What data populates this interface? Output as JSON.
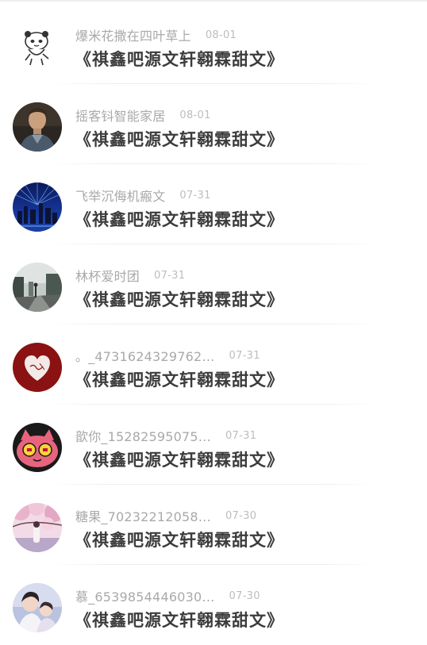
{
  "comments": [
    {
      "user": "爆米花撒在四叶草上",
      "date": "08-01",
      "text": "《祺鑫吧源文轩翱霖甜文》",
      "avatar_icon": "panda-sticker-avatar"
    },
    {
      "user": "摇客钭智能家居",
      "date": "08-01",
      "text": "《祺鑫吧源文轩翱霖甜文》",
      "avatar_icon": "man-portrait-avatar"
    },
    {
      "user": "飞举沉侮机瘢文",
      "date": "07-31",
      "text": "《祺鑫吧源文轩翱霖甜文》",
      "avatar_icon": "city-night-avatar"
    },
    {
      "user": "林杯爱时团",
      "date": "07-31",
      "text": "《祺鑫吧源文轩翱霖甜文》",
      "avatar_icon": "city-street-avatar"
    },
    {
      "user": "。_4731624329762…",
      "date": "07-31",
      "text": "《祺鑫吧源文轩翱霖甜文》",
      "avatar_icon": "red-heart-avatar"
    },
    {
      "user": "歆你_15282595075…",
      "date": "07-31",
      "text": "《祺鑫吧源文轩翱霖甜文》",
      "avatar_icon": "cartoon-cat-avatar"
    },
    {
      "user": "糖果_70232212058…",
      "date": "07-30",
      "text": "《祺鑫吧源文轩翱霖甜文》",
      "avatar_icon": "cherry-blossom-avatar"
    },
    {
      "user": "慕_6539854446030…",
      "date": "07-30",
      "text": "《祺鑫吧源文轩翱霖甜文》",
      "avatar_icon": "couple-photo-avatar"
    }
  ]
}
